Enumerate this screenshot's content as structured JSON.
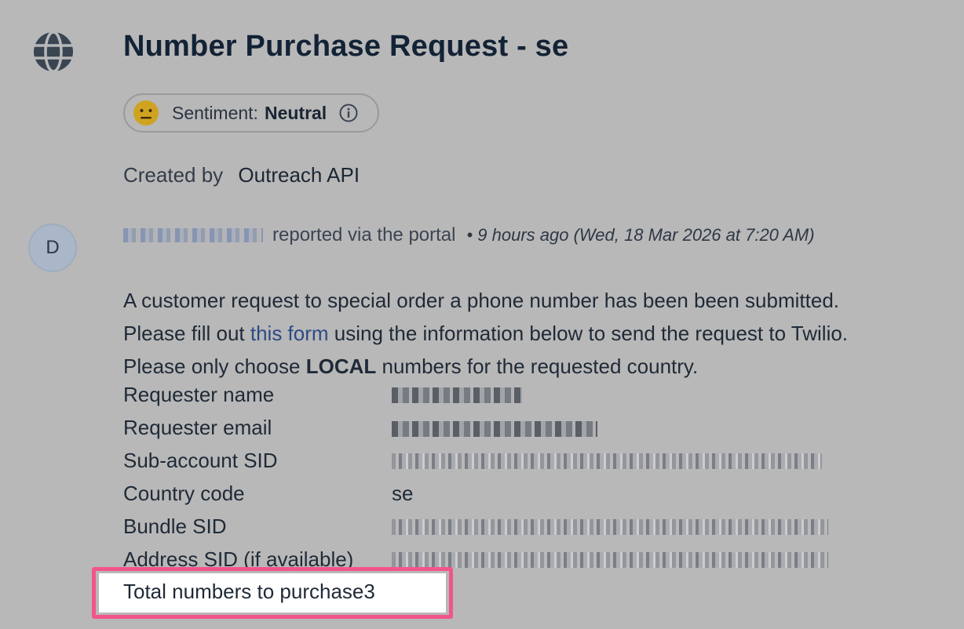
{
  "ticket": {
    "title": "Number Purchase Request - se",
    "sentiment": {
      "label": "Sentiment:",
      "value": "Neutral"
    },
    "created_by": {
      "label": "Created by",
      "name": "Outreach API"
    }
  },
  "activity": {
    "avatar_initial": "D",
    "reported_via": "reported via the portal",
    "meta": "• 9 hours ago (Wed, 18 Mar 2026 at 7:20 AM)"
  },
  "message": {
    "line1": "A customer request to special order a phone number has been been submitted.",
    "line2_before": "Please fill out ",
    "line2_link": "this form",
    "line2_after": " using the information below to send the request to Twilio.",
    "line3_before": "Please only choose ",
    "line3_bold": "LOCAL",
    "line3_after": " numbers for the requested country."
  },
  "fields": {
    "requester_name_label": "Requester name",
    "requester_email_label": "Requester email",
    "subaccount_sid_label": "Sub-account SID",
    "country_code_label": "Country code",
    "country_code_value": "se",
    "bundle_sid_label": "Bundle SID",
    "address_sid_label": "Address SID (if available)",
    "total_numbers_label": "Total numbers to purchase3"
  },
  "colors": {
    "background": "#b8b8b8",
    "highlight": "#f2558a",
    "link": "#2c4a86"
  },
  "icons": [
    "globe-icon",
    "neutral-face-icon",
    "info-icon"
  ]
}
